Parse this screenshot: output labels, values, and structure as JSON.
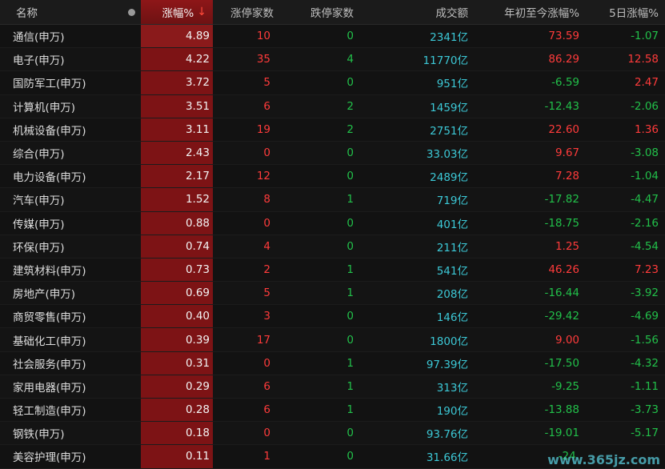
{
  "header": {
    "name": "名称",
    "pct": "涨幅%",
    "sort_arrow": "↓",
    "up_count": "涨停家数",
    "down_count": "跌停家数",
    "volume": "成交额",
    "ytd": "年初至今涨幅%",
    "five_day": "5日涨幅%"
  },
  "rows": [
    {
      "name": "通信(申万)",
      "pct": "4.89",
      "up": "10",
      "down": "0",
      "vol": "2341亿",
      "ytd": "73.59",
      "d5": "-1.07"
    },
    {
      "name": "电子(申万)",
      "pct": "4.22",
      "up": "35",
      "down": "4",
      "vol": "11770亿",
      "ytd": "86.29",
      "d5": "12.58"
    },
    {
      "name": "国防军工(申万)",
      "pct": "3.72",
      "up": "5",
      "down": "0",
      "vol": "951亿",
      "ytd": "-6.59",
      "d5": "2.47"
    },
    {
      "name": "计算机(申万)",
      "pct": "3.51",
      "up": "6",
      "down": "2",
      "vol": "1459亿",
      "ytd": "-12.43",
      "d5": "-2.06"
    },
    {
      "name": "机械设备(申万)",
      "pct": "3.11",
      "up": "19",
      "down": "2",
      "vol": "2751亿",
      "ytd": "22.60",
      "d5": "1.36"
    },
    {
      "name": "综合(申万)",
      "pct": "2.43",
      "up": "0",
      "down": "0",
      "vol": "33.03亿",
      "ytd": "9.67",
      "d5": "-3.08"
    },
    {
      "name": "电力设备(申万)",
      "pct": "2.17",
      "up": "12",
      "down": "0",
      "vol": "2489亿",
      "ytd": "7.28",
      "d5": "-1.04"
    },
    {
      "name": "汽车(申万)",
      "pct": "1.52",
      "up": "8",
      "down": "1",
      "vol": "719亿",
      "ytd": "-17.82",
      "d5": "-4.47"
    },
    {
      "name": "传媒(申万)",
      "pct": "0.88",
      "up": "0",
      "down": "0",
      "vol": "401亿",
      "ytd": "-18.75",
      "d5": "-2.16"
    },
    {
      "name": "环保(申万)",
      "pct": "0.74",
      "up": "4",
      "down": "0",
      "vol": "211亿",
      "ytd": "1.25",
      "d5": "-4.54"
    },
    {
      "name": "建筑材料(申万)",
      "pct": "0.73",
      "up": "2",
      "down": "1",
      "vol": "541亿",
      "ytd": "46.26",
      "d5": "7.23"
    },
    {
      "name": "房地产(申万)",
      "pct": "0.69",
      "up": "5",
      "down": "1",
      "vol": "208亿",
      "ytd": "-16.44",
      "d5": "-3.92"
    },
    {
      "name": "商贸零售(申万)",
      "pct": "0.40",
      "up": "3",
      "down": "0",
      "vol": "146亿",
      "ytd": "-29.42",
      "d5": "-4.69"
    },
    {
      "name": "基础化工(申万)",
      "pct": "0.39",
      "up": "17",
      "down": "0",
      "vol": "1800亿",
      "ytd": "9.00",
      "d5": "-1.56"
    },
    {
      "name": "社会服务(申万)",
      "pct": "0.31",
      "up": "0",
      "down": "1",
      "vol": "97.39亿",
      "ytd": "-17.50",
      "d5": "-4.32"
    },
    {
      "name": "家用电器(申万)",
      "pct": "0.29",
      "up": "6",
      "down": "1",
      "vol": "313亿",
      "ytd": "-9.25",
      "d5": "-1.11"
    },
    {
      "name": "轻工制造(申万)",
      "pct": "0.28",
      "up": "6",
      "down": "1",
      "vol": "190亿",
      "ytd": "-13.88",
      "d5": "-3.73"
    },
    {
      "name": "钢铁(申万)",
      "pct": "0.18",
      "up": "0",
      "down": "0",
      "vol": "93.76亿",
      "ytd": "-19.01",
      "d5": "-5.17"
    },
    {
      "name": "美容护理(申万)",
      "pct": "0.11",
      "up": "1",
      "down": "0",
      "vol": "31.66亿",
      "ytd": "-24.",
      "d5": ""
    }
  ],
  "watermark": "www.365jz.com",
  "colors": {
    "up": "#ff3b3b",
    "down": "#22c04a",
    "volume": "#3cc8d6",
    "highlight": "#7d1315"
  }
}
